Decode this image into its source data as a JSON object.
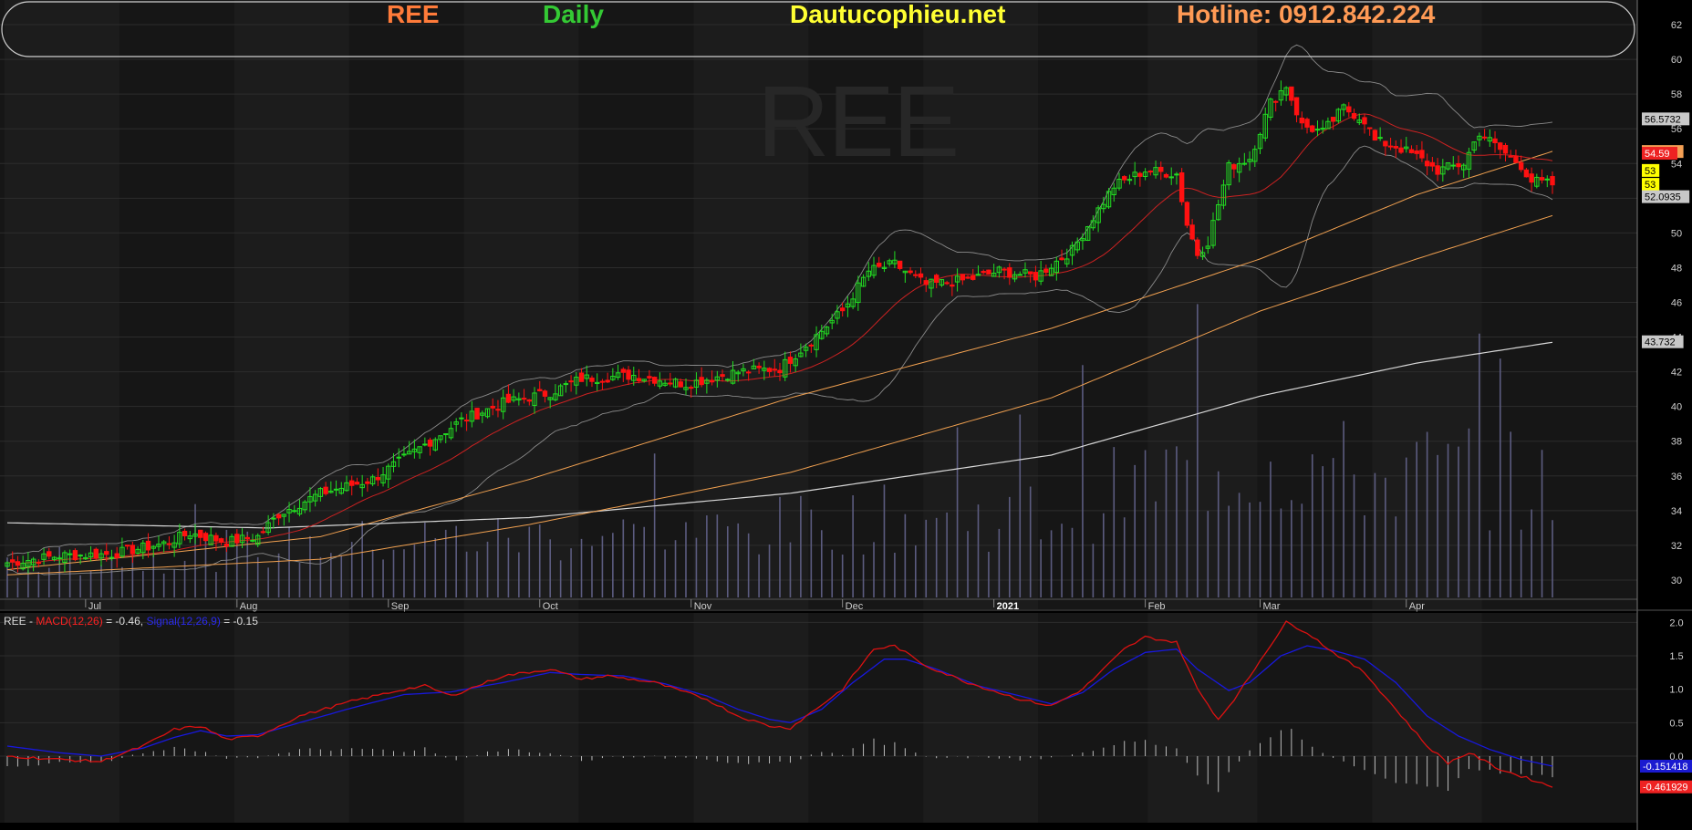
{
  "header": {
    "symbol": "REE",
    "period": "Daily",
    "site": "Dautucophieu.net",
    "hotline": "Hotline: 0912.842.224",
    "colors": {
      "symbol": "#ff7b3a",
      "period": "#34c934",
      "site": "#ffff33",
      "hotline": "#ff9a55"
    }
  },
  "watermark": "REE",
  "macd_legend": {
    "symbol": "REE -",
    "macd_label": "MACD(12,26)",
    "macd_value": "= -0.46,",
    "signal_label": "Signal(12,26,9)",
    "signal_value": "= -0.15"
  },
  "chart_data": [
    {
      "type": "candlestick",
      "ylim": [
        29,
        63
      ],
      "y_ticks": [
        30,
        32,
        34,
        36,
        38,
        40,
        42,
        44,
        46,
        48,
        50,
        52,
        54,
        56,
        58,
        60,
        62
      ],
      "x_labels": [
        "Jul",
        "Aug",
        "Sep",
        "Oct",
        "Nov",
        "Dec",
        "2021",
        "Feb",
        "Mar",
        "Apr"
      ],
      "right_labels": [
        {
          "text": "56.5732",
          "value": 56.57,
          "bg": "#c8c8c8",
          "fg": "#000000"
        },
        {
          "text": "54.688",
          "value": 54.69,
          "bg": "#f5a055",
          "fg": "#000000"
        },
        {
          "text": "54.59",
          "value": 54.59,
          "bg": "#ee2222",
          "fg": "#ffffff"
        },
        {
          "text": "53",
          "value": 53.6,
          "bg": "#ffff00",
          "fg": "#000000"
        },
        {
          "text": "53",
          "value": 52.8,
          "bg": "#ffff00",
          "fg": "#000000"
        },
        {
          "text": "52.0935",
          "value": 52.09,
          "bg": "#c8c8c8",
          "fg": "#000000"
        },
        {
          "text": "43.732",
          "value": 43.73,
          "bg": "#c8c8c8",
          "fg": "#000000"
        }
      ],
      "colors": {
        "up": "#22dd22",
        "down": "#ff1111",
        "ma20": "#cc2222",
        "ma50": "#f0a050",
        "ma200": "#d8d8d8",
        "bands": "#8a8a8a",
        "volume": "#5c5c80"
      },
      "close_anchors": [
        [
          0,
          31.0
        ],
        [
          10,
          31.4
        ],
        [
          20,
          31.5
        ],
        [
          30,
          32.1
        ],
        [
          35,
          32.7
        ],
        [
          42,
          32.2
        ],
        [
          48,
          32.5
        ],
        [
          52,
          33.8
        ],
        [
          60,
          35.0
        ],
        [
          70,
          35.8
        ],
        [
          80,
          37.8
        ],
        [
          87,
          39.2
        ],
        [
          95,
          40.2
        ],
        [
          104,
          40.8
        ],
        [
          110,
          41.6
        ],
        [
          120,
          41.8
        ],
        [
          130,
          41.3
        ],
        [
          140,
          42.0
        ],
        [
          148,
          42.2
        ],
        [
          154,
          43.8
        ],
        [
          160,
          45.5
        ],
        [
          165,
          47.8
        ],
        [
          170,
          48.2
        ],
        [
          176,
          47.0
        ],
        [
          184,
          47.3
        ],
        [
          190,
          47.8
        ],
        [
          197,
          47.5
        ],
        [
          204,
          49.0
        ],
        [
          208,
          50.9
        ],
        [
          212,
          52.7
        ],
        [
          218,
          53.6
        ],
        [
          224,
          53.4
        ],
        [
          226,
          50.5
        ],
        [
          228,
          48.8
        ],
        [
          230,
          49.5
        ],
        [
          234,
          53.8
        ],
        [
          238,
          54.3
        ],
        [
          242,
          57.5
        ],
        [
          245,
          58.5
        ],
        [
          248,
          56.2
        ],
        [
          252,
          55.8
        ],
        [
          256,
          57.2
        ],
        [
          260,
          56.5
        ],
        [
          262,
          55.3
        ],
        [
          266,
          55.0
        ],
        [
          270,
          54.4
        ],
        [
          274,
          53.6
        ],
        [
          279,
          54.0
        ],
        [
          282,
          55.8
        ],
        [
          286,
          54.8
        ],
        [
          290,
          53.9
        ],
        [
          292,
          53.0
        ],
        [
          296,
          52.8
        ]
      ],
      "volume_anchors": [
        [
          0,
          1.5
        ],
        [
          20,
          2.0
        ],
        [
          40,
          2.3
        ],
        [
          60,
          2.6
        ],
        [
          80,
          2.9
        ],
        [
          100,
          3.0
        ],
        [
          120,
          3.1
        ],
        [
          140,
          3.3
        ],
        [
          160,
          3.8
        ],
        [
          180,
          4.0
        ],
        [
          200,
          4.1
        ],
        [
          215,
          5.5
        ],
        [
          230,
          6.6
        ],
        [
          245,
          6.9
        ],
        [
          260,
          6.0
        ],
        [
          280,
          6.3
        ],
        [
          296,
          5.2
        ]
      ]
    },
    {
      "type": "line",
      "title": "MACD",
      "ylim": [
        -0.9,
        2.1
      ],
      "y_ticks": [
        0.0,
        0.5,
        1.0,
        1.5,
        2.0
      ],
      "right_labels": [
        {
          "text": "-0.151418",
          "value": -0.15,
          "bg": "#1a1ad0",
          "fg": "#ffffff"
        },
        {
          "text": "-0.461929",
          "value": -0.46,
          "bg": "#ee2222",
          "fg": "#ffffff"
        }
      ],
      "series": [
        {
          "name": "MACD(12,26)",
          "color": "#dd1111"
        },
        {
          "name": "Signal(12,26,9)",
          "color": "#1818dd"
        },
        {
          "color": "#bbbbbb"
        }
      ],
      "macd_anchors": [
        [
          0,
          0.0
        ],
        [
          10,
          -0.05
        ],
        [
          18,
          -0.08
        ],
        [
          26,
          0.15
        ],
        [
          32,
          0.4
        ],
        [
          37,
          0.45
        ],
        [
          42,
          0.25
        ],
        [
          48,
          0.3
        ],
        [
          56,
          0.6
        ],
        [
          66,
          0.82
        ],
        [
          76,
          1.0
        ],
        [
          80,
          1.05
        ],
        [
          85,
          0.9
        ],
        [
          95,
          1.2
        ],
        [
          104,
          1.3
        ],
        [
          110,
          1.15
        ],
        [
          115,
          1.2
        ],
        [
          124,
          1.1
        ],
        [
          134,
          0.85
        ],
        [
          140,
          0.6
        ],
        [
          146,
          0.45
        ],
        [
          150,
          0.42
        ],
        [
          160,
          1.0
        ],
        [
          166,
          1.6
        ],
        [
          170,
          1.65
        ],
        [
          176,
          1.35
        ],
        [
          184,
          1.1
        ],
        [
          194,
          0.85
        ],
        [
          200,
          0.75
        ],
        [
          206,
          1.0
        ],
        [
          214,
          1.6
        ],
        [
          218,
          1.78
        ],
        [
          224,
          1.7
        ],
        [
          228,
          1.0
        ],
        [
          232,
          0.55
        ],
        [
          236,
          0.95
        ],
        [
          241,
          1.55
        ],
        [
          245,
          2.0
        ],
        [
          249,
          1.85
        ],
        [
          254,
          1.55
        ],
        [
          260,
          1.25
        ],
        [
          266,
          0.7
        ],
        [
          272,
          0.15
        ],
        [
          276,
          -0.1
        ],
        [
          280,
          0.05
        ],
        [
          286,
          -0.2
        ],
        [
          292,
          -0.35
        ],
        [
          296,
          -0.46
        ]
      ],
      "signal_anchors": [
        [
          0,
          0.15
        ],
        [
          10,
          0.05
        ],
        [
          18,
          0.0
        ],
        [
          26,
          0.12
        ],
        [
          32,
          0.28
        ],
        [
          37,
          0.38
        ],
        [
          42,
          0.3
        ],
        [
          48,
          0.32
        ],
        [
          56,
          0.5
        ],
        [
          66,
          0.72
        ],
        [
          76,
          0.92
        ],
        [
          85,
          0.96
        ],
        [
          95,
          1.1
        ],
        [
          104,
          1.25
        ],
        [
          110,
          1.22
        ],
        [
          118,
          1.2
        ],
        [
          126,
          1.08
        ],
        [
          134,
          0.9
        ],
        [
          140,
          0.7
        ],
        [
          146,
          0.55
        ],
        [
          150,
          0.5
        ],
        [
          156,
          0.7
        ],
        [
          162,
          1.1
        ],
        [
          168,
          1.45
        ],
        [
          172,
          1.45
        ],
        [
          178,
          1.3
        ],
        [
          186,
          1.05
        ],
        [
          194,
          0.9
        ],
        [
          200,
          0.78
        ],
        [
          206,
          0.95
        ],
        [
          212,
          1.3
        ],
        [
          218,
          1.55
        ],
        [
          224,
          1.6
        ],
        [
          228,
          1.3
        ],
        [
          234,
          0.98
        ],
        [
          238,
          1.1
        ],
        [
          244,
          1.5
        ],
        [
          249,
          1.65
        ],
        [
          254,
          1.58
        ],
        [
          260,
          1.45
        ],
        [
          266,
          1.1
        ],
        [
          272,
          0.6
        ],
        [
          278,
          0.3
        ],
        [
          284,
          0.1
        ],
        [
          290,
          -0.05
        ],
        [
          296,
          -0.15
        ]
      ]
    }
  ]
}
